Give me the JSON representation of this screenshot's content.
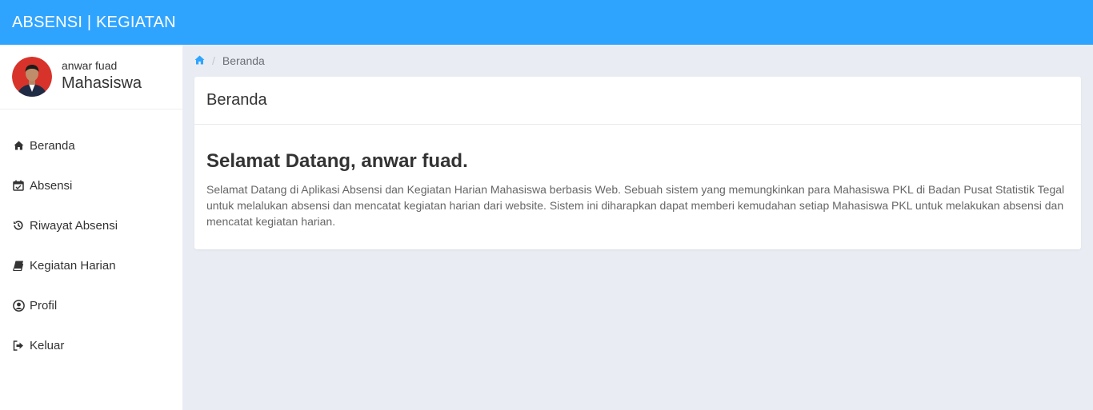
{
  "app": {
    "brand": "ABSENSI | KEGIATAN",
    "colors": {
      "topbar": "#2fa4ff",
      "accent": "#2fa4ff",
      "background": "#e9edf3",
      "sidebar": "#ffffff"
    }
  },
  "user": {
    "name": "anwar fuad",
    "role": "Mahasiswa",
    "avatar_icon": "user-avatar-photo"
  },
  "sidebar": {
    "items": [
      {
        "label": "Beranda",
        "icon": "home-icon"
      },
      {
        "label": "Absensi",
        "icon": "calendar-check-icon"
      },
      {
        "label": "Riwayat Absensi",
        "icon": "history-icon"
      },
      {
        "label": "Kegiatan Harian",
        "icon": "book-icon"
      },
      {
        "label": "Profil",
        "icon": "user-circle-icon"
      },
      {
        "label": "Keluar",
        "icon": "sign-out-icon"
      }
    ]
  },
  "breadcrumb": {
    "home_icon": "home-icon",
    "current": "Beranda"
  },
  "card": {
    "title": "Beranda",
    "welcome_title": "Selamat Datang, anwar fuad.",
    "welcome_text": "Selamat Datang di Aplikasi Absensi dan Kegiatan Harian Mahasiswa berbasis Web. Sebuah sistem yang memungkinkan para Mahasiswa PKL di Badan Pusat Statistik Tegal untuk melalukan absensi dan mencatat kegiatan harian dari website. Sistem ini diharapkan dapat memberi kemudahan setiap Mahasiswa PKL untuk melakukan absensi dan mencatat kegiatan harian."
  }
}
